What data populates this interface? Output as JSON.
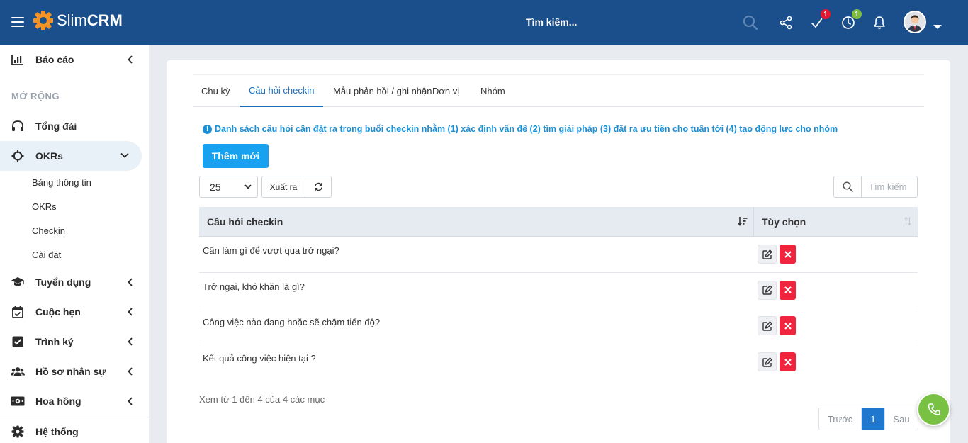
{
  "header": {
    "brand_light": "Slim",
    "brand_bold": "CRM",
    "search_placeholder": "Tìm kiếm...",
    "tasks_badge": "1",
    "clock_badge": "1",
    "colors": {
      "bar": "#1a4f8b",
      "badge_red": "#e8172f",
      "badge_green": "#7cbd3c",
      "logo_orange": "#f39325"
    }
  },
  "sidebar": {
    "report": "Báo cáo",
    "section_title": "MỞ RỘNG",
    "switchboard": "Tổng đài",
    "okrs_group": "OKRs",
    "okrs_sub": [
      "Bảng thông tin",
      "OKRs",
      "Checkin",
      "Cài đặt"
    ],
    "recruit": "Tuyển dụng",
    "appointments": "Cuộc hẹn",
    "approvals": "Trình ký",
    "hr_profiles": "Hồ sơ nhân sự",
    "commission": "Hoa hồng",
    "system": "Hệ thống"
  },
  "tabs": [
    "Chu kỳ",
    "Câu hỏi checkin",
    "Mẫu phản hồi / ghi nhận",
    "Đơn vị",
    "Nhóm"
  ],
  "info_text": "Danh sách câu hỏi cần đặt ra trong buổi checkin nhằm (1) xác định vấn đề (2) tìm giải pháp (3) đặt ra ưu tiên cho tuần tới (4) tạo động lực cho nhóm",
  "add_button": "Thêm mới",
  "page_size": "25",
  "export_button": "Xuất ra",
  "table_search_placeholder": "Tìm kiếm",
  "table": {
    "col_question": "Câu hỏi checkin",
    "col_options": "Tùy chọn",
    "rows": [
      "Cần làm gì để vượt qua trở ngại?",
      "Trở ngại, khó khăn là gì?",
      "Công việc nào đang hoặc sẽ chậm tiến độ?",
      "Kết quả công việc hiện tại ?"
    ]
  },
  "summary": "Xem từ 1 đến 4 của 4 các mục",
  "pagination": {
    "prev": "Trước",
    "current": "1",
    "next": "Sau"
  }
}
